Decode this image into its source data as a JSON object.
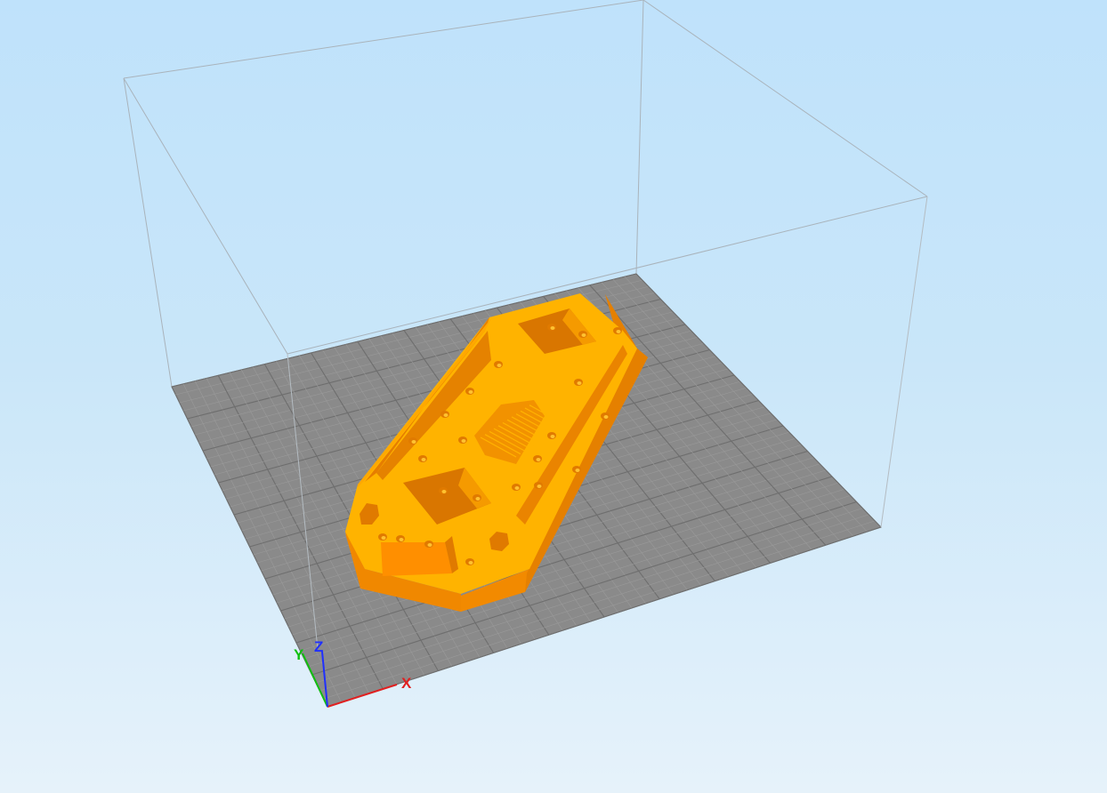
{
  "viewport": {
    "background_top": "#bfe2fb",
    "background_bottom": "#e6f2fa"
  },
  "build_plate": {
    "color": "#8a8a8a",
    "grid_line_color": "#707070",
    "minor_divisions": 40,
    "major_every": 4
  },
  "build_volume": {
    "edge_color": "#a9b3bb"
  },
  "model": {
    "top_color": "#ffb300",
    "side_color": "#f28a00",
    "dark_side_color": "#e07a00"
  },
  "axes": {
    "x_label": "X",
    "y_label": "Y",
    "z_label": "Z",
    "x_color": "#e02020",
    "y_color": "#10c010",
    "z_color": "#2030ff"
  }
}
